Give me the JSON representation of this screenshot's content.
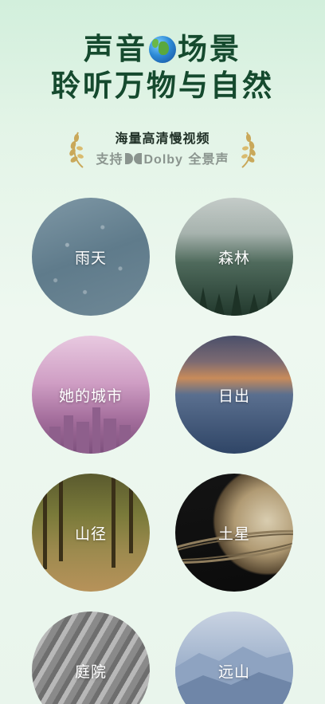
{
  "header": {
    "title_line1_left": "声音",
    "title_line1_right": "场景",
    "title_line2": "聆听万物与自然",
    "globe_icon": "globe-icon",
    "subtitle": "海量高清慢视频",
    "support_prefix": "支持",
    "dolby_word": "Dolby",
    "support_suffix": "全景声",
    "laurel_icon": "laurel-icon"
  },
  "scenes": [
    {
      "label": "雨天"
    },
    {
      "label": "森林"
    },
    {
      "label": "她的城市"
    },
    {
      "label": "日出"
    },
    {
      "label": "山径"
    },
    {
      "label": "土星"
    },
    {
      "label": "庭院"
    },
    {
      "label": "远山"
    }
  ],
  "colors": {
    "title": "#154a2e",
    "subtitle": "#1f2f26",
    "muted": "#8a948e",
    "laurel": "#c9a85a"
  }
}
